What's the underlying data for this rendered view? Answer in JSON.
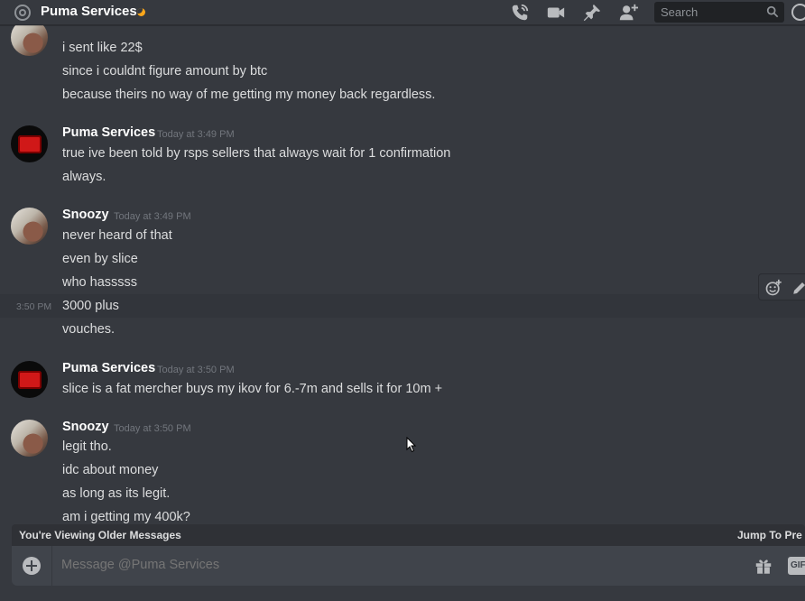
{
  "header": {
    "channel_name": "Puma Services",
    "search_placeholder": "Search"
  },
  "messages": {
    "group0": {
      "lines": [
        "i sent like 22$",
        "since i couldnt figure amount by btc",
        "because theirs no way of me getting my money back regardless."
      ]
    },
    "group1": {
      "author": "Puma Services",
      "timestamp": "Today at 3:49 PM",
      "lines": [
        "true ive been told by rsps sellers that always  wait for 1 confirmation",
        "always."
      ]
    },
    "group2": {
      "author": "Snoozy",
      "timestamp": "Today at 3:49 PM",
      "lines": [
        "never heard of that",
        "even by slice",
        "who hasssss",
        "3000 plus",
        "vouches."
      ],
      "hover_time": "3:50 PM"
    },
    "group3": {
      "author": "Puma Services",
      "timestamp": "Today at 3:50 PM",
      "lines": [
        "slice is a fat mercher buys my ikov for 6.-7m and sells it for 10m +"
      ]
    },
    "group4": {
      "author": "Snoozy",
      "timestamp": "Today at 3:50 PM",
      "lines": [
        "legit tho.",
        "idc about money",
        "as long as its legit.",
        "am i getting my 400k?"
      ]
    }
  },
  "older_bar": {
    "notice": "You're Viewing Older Messages",
    "jump": "Jump To Pre"
  },
  "composer": {
    "placeholder": "Message @Puma Services",
    "gif_label": "GIF"
  },
  "colors": {
    "background": "#36393f",
    "status_idle": "#faa61a"
  }
}
